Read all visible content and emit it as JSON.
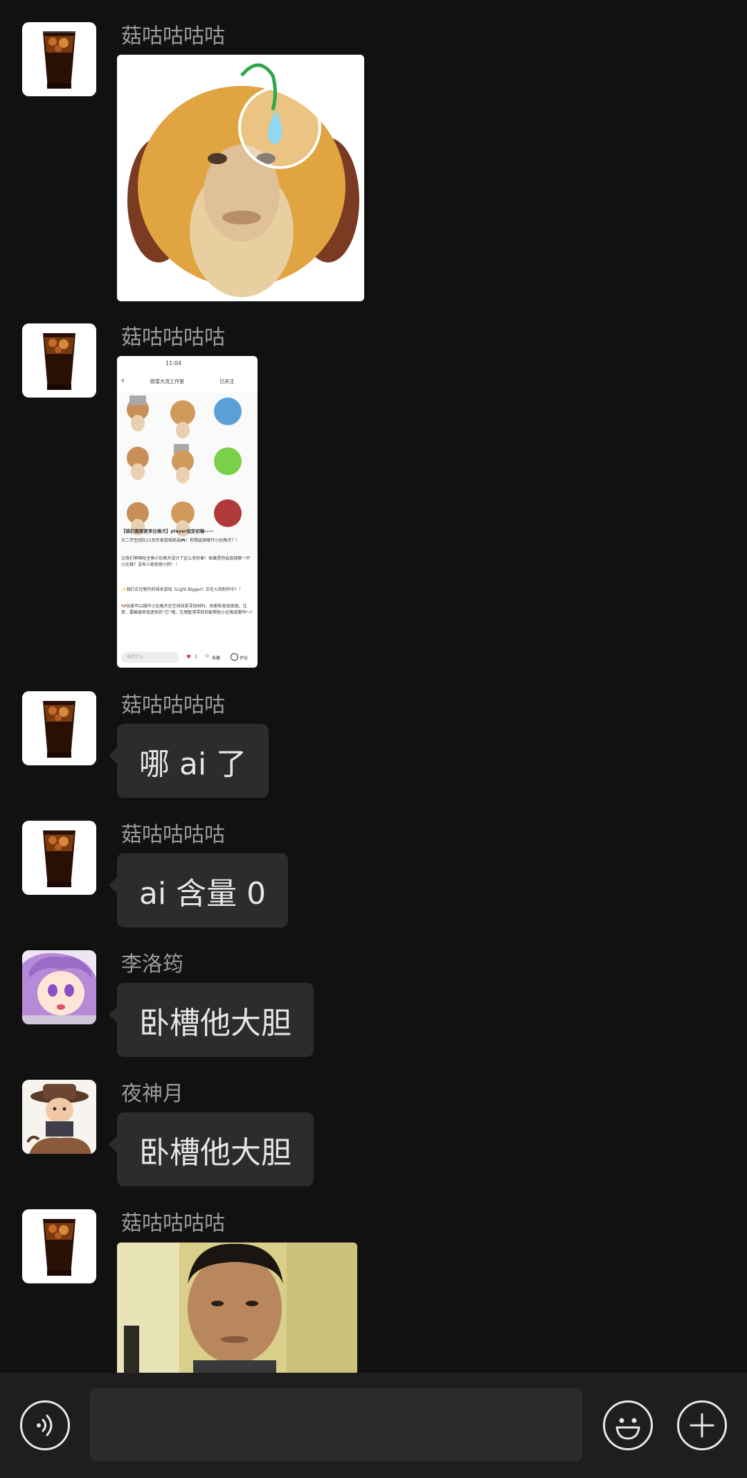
{
  "messages": [
    {
      "sender": "菇咕咕咕咕",
      "type": "image",
      "image": "dog-face-sticker"
    },
    {
      "sender": "菇咕咕咕咕",
      "type": "image",
      "image": "phone-screenshot",
      "screenshot": {
        "status_time": "11:04",
        "page_title": "欧富大流工作室",
        "follow_label": "已关注",
        "post_title": "【我们需要更多比格犬】player设定初稿——",
        "line1": "大二学生团队21天开发游戏挑战🎮！你想选择哪只小比格犬？！",
        "line2": "😊我们萌萌哒主角小比格犬设计了这么多形象！如果是你会选择哪一只小比格？没有人能拒绝小狗！！",
        "line3": "✨我们正在制作的闯关游戏《Light Bigger》正在火热制作中！！",
        "line4": "🐶玩家可以操作小比格犬在空间站里寻找材料、探索和发现真相。注意，要躲避来追逐你的“它”哦，在理智清零前你能帮助小比格逃脱吗～?",
        "comment_placeholder": "说点什么...",
        "like_count": "1",
        "collect_label": "收藏",
        "comment_label": "评论"
      }
    },
    {
      "sender": "菇咕咕咕咕",
      "type": "text",
      "text": "哪 ai 了"
    },
    {
      "sender": "菇咕咕咕咕",
      "type": "text",
      "text": "ai 含量 0"
    },
    {
      "sender": "李洛筠",
      "type": "text",
      "text": "卧槽他大胆"
    },
    {
      "sender": "夜神月",
      "type": "text",
      "text": "卧槽他大胆"
    },
    {
      "sender": "菇咕咕咕咕",
      "type": "image",
      "image": "man-photo"
    }
  ],
  "input_bar": {
    "voice_icon": "voice-icon",
    "emoji_icon": "emoji-icon",
    "plus_icon": "plus-icon",
    "input_value": ""
  }
}
